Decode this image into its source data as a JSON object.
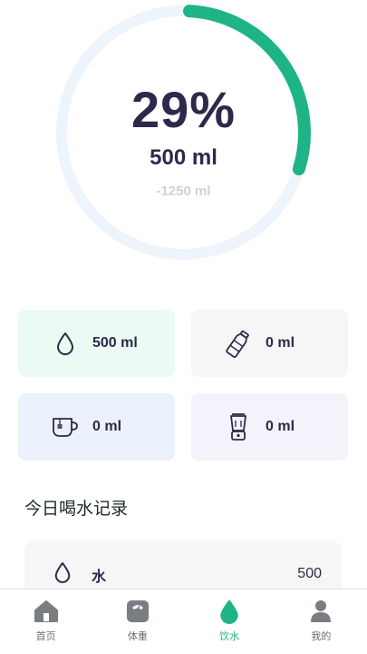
{
  "colors": {
    "accent": "#1fb487",
    "ring_track": "#eef4fc",
    "text_dark": "#2c2a4a",
    "muted": "#cfd1dc",
    "tab_icon": "#7a7d82"
  },
  "progress": {
    "percent_label": "29%",
    "fraction": 0.29,
    "intake": "500 ml",
    "remaining": "-1250 ml"
  },
  "drink_cards": [
    {
      "icon": "water-drop-icon",
      "value": "500 ml"
    },
    {
      "icon": "bottle-icon",
      "value": "0 ml"
    },
    {
      "icon": "tea-cup-icon",
      "value": "0 ml"
    },
    {
      "icon": "blender-icon",
      "value": "0 ml"
    }
  ],
  "records": {
    "title": "今日喝水记录",
    "items": [
      {
        "icon": "water-drop-icon",
        "name": "水",
        "value": "500"
      }
    ]
  },
  "tabs": [
    {
      "icon": "home-icon",
      "label": "首页",
      "active": false
    },
    {
      "icon": "scale-icon",
      "label": "体重",
      "active": false
    },
    {
      "icon": "water-drop-icon",
      "label": "饮水",
      "active": true
    },
    {
      "icon": "user-icon",
      "label": "我的",
      "active": false
    }
  ]
}
